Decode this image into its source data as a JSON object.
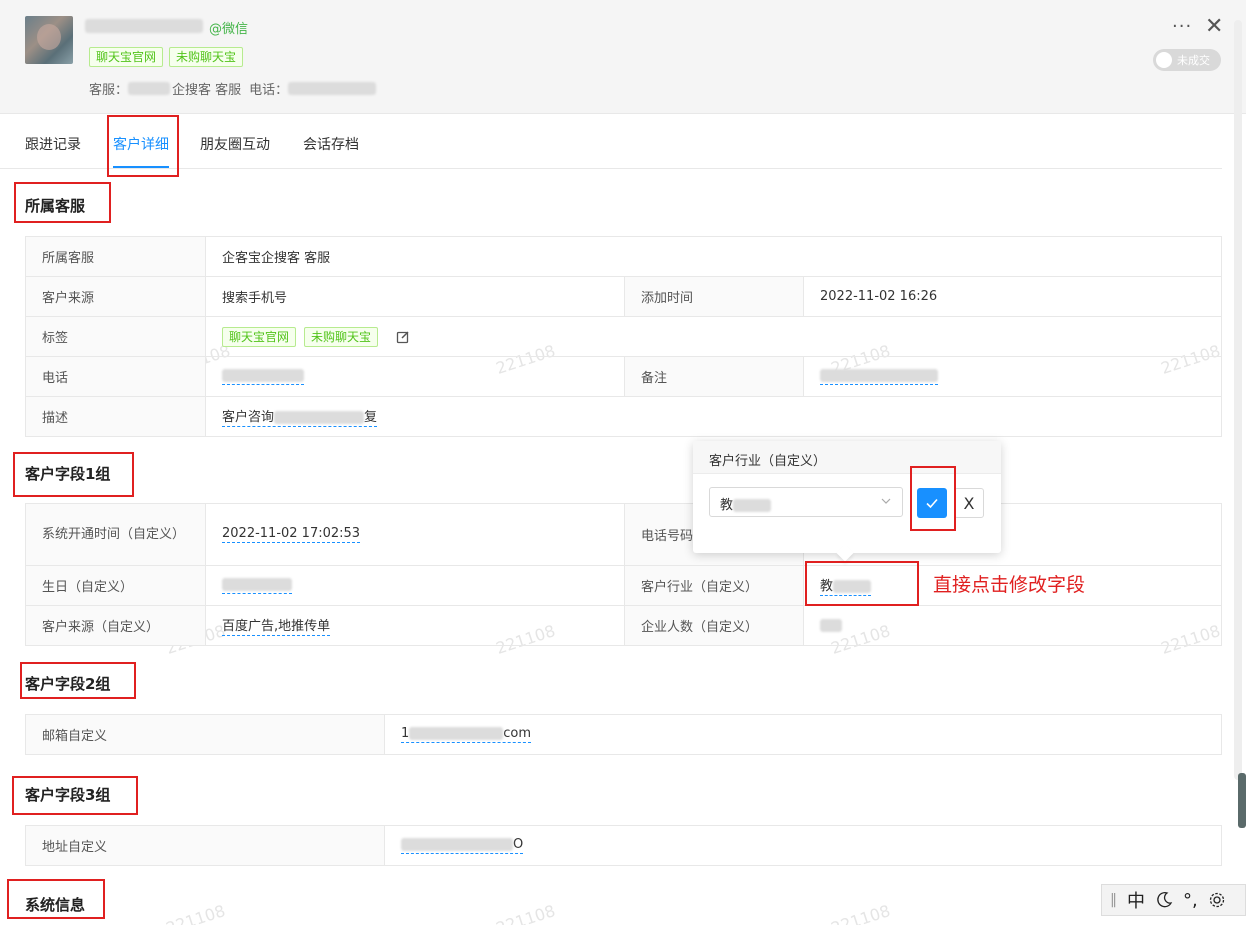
{
  "header": {
    "wechat_suffix": "@微信",
    "tags": [
      "聊天宝官网",
      "未购聊天宝"
    ],
    "service_label": "客服：",
    "service_value": "企搜客 客服",
    "phone_label": "电话：",
    "more_glyph": "···",
    "close_glyph": "✕",
    "deal_toggle_label": "未成交"
  },
  "tabs": [
    {
      "label": "跟进记录"
    },
    {
      "label": "客户详细"
    },
    {
      "label": "朋友圈互动"
    },
    {
      "label": "会话存档"
    }
  ],
  "sections": {
    "service": {
      "title": "所属客服",
      "rows": {
        "owner_label": "所属客服",
        "owner_value": "企客宝企搜客 客服",
        "source_label": "客户来源",
        "source_value": "搜索手机号",
        "added_label": "添加时间",
        "added_value": "2022-11-02 16:26",
        "tags_label": "标签",
        "tags": [
          "聊天宝官网",
          "未购聊天宝"
        ],
        "phone_label": "电话",
        "remark_label": "备注",
        "desc_label": "描述",
        "desc_value_a": "客户咨询",
        "desc_value_b": "复"
      }
    },
    "group1": {
      "title": "客户字段1组",
      "rows": {
        "open_time_label": "系统开通时间（自定义）",
        "open_time_value": "2022-11-02 17:02:53",
        "phone_code_label": "电话号码",
        "birthday_label": "生日（自定义）",
        "industry_label": "客户行业（自定义）",
        "industry_value": "教",
        "source2_label": "客户来源（自定义）",
        "source2_value": "百度广告,地推传单",
        "staff_label": "企业人数（自定义）"
      }
    },
    "group2": {
      "title": "客户字段2组",
      "email_label": "邮箱自定义",
      "email_prefix": "1",
      "email_suffix": "com"
    },
    "group3": {
      "title": "客户字段3组",
      "address_label": "地址自定义",
      "address_suffix": "O"
    },
    "system": {
      "title": "系统信息"
    }
  },
  "popover": {
    "title": "客户行业（自定义）",
    "select_value": "教",
    "cancel_glyph": "X"
  },
  "annotation": "直接点击修改字段",
  "ime": {
    "lang": "中",
    "punct": "°,"
  },
  "watermark": "221108",
  "colors": {
    "accent": "#1890ff",
    "annotation_red": "#e02020",
    "tag_green": "#52c41a"
  }
}
